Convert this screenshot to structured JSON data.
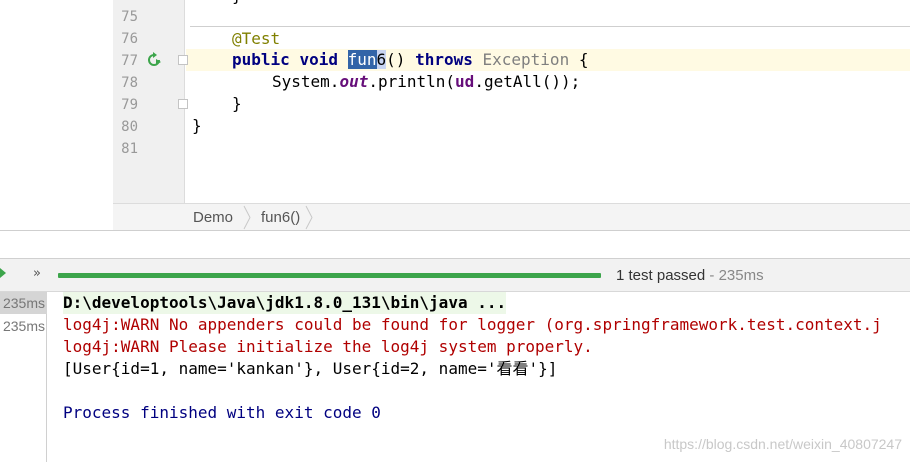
{
  "editor": {
    "line_numbers": [
      "75",
      "76",
      "77",
      "78",
      "79",
      "80",
      "81"
    ],
    "code": {
      "annotation": "@Test",
      "kw_public": "public",
      "kw_void": "void",
      "method_sel_part": "fun",
      "method_rest": "6",
      "params": "() ",
      "kw_throws": "throws",
      "exception": "Exception",
      "open_brace": " {",
      "stmt_prefix": "System.",
      "stmt_field": "out",
      "stmt_mid": ".println(",
      "stmt_var": "ud",
      "stmt_suffix": ".getAll());",
      "close_inner": "}",
      "close_outer": "}",
      "top_brace": "}"
    },
    "breadcrumb": [
      "Demo",
      "fun6()"
    ]
  },
  "run": {
    "status_main": "1 test passed",
    "status_dim": " - 235ms",
    "progress_percent": 100,
    "more_label": "»",
    "tree": [
      "235ms",
      "235ms"
    ]
  },
  "console": {
    "lines": [
      "D:\\developtools\\Java\\jdk1.8.0_131\\bin\\java ...",
      "log4j:WARN No appenders could be found for logger (org.springframework.test.context.j",
      "log4j:WARN Please initialize the log4j system properly.",
      "[User{id=1, name='kankan'}, User{id=2, name='看看'}]",
      "",
      "Process finished with exit code 0"
    ],
    "watermark": "https://blog.csdn.net/weixin_40807247"
  },
  "colors": {
    "progress": "#3ca54b",
    "warn": "#b00000",
    "keyword": "#000080",
    "annotation": "#808000"
  }
}
